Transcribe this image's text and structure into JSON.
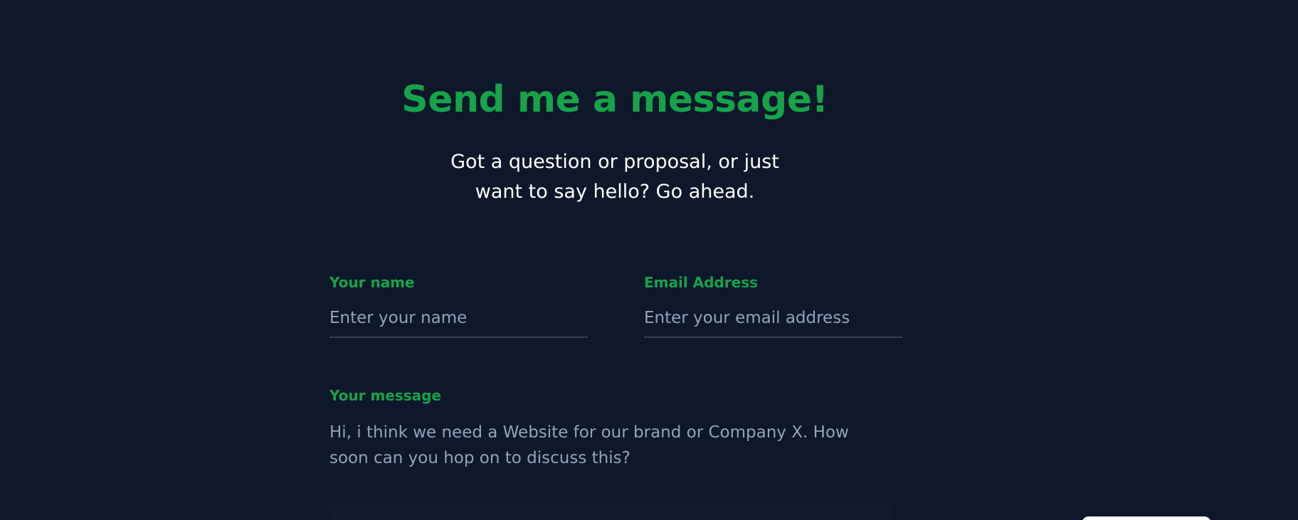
{
  "section": {
    "title": "Send me a message!",
    "subtitle": "Got a question or proposal, or just want to say hello? Go ahead."
  },
  "form": {
    "name": {
      "label": "Your name",
      "placeholder": "Enter your name",
      "value": ""
    },
    "email": {
      "label": "Email Address",
      "placeholder": "Enter your email address",
      "value": ""
    },
    "message": {
      "label": "Your message",
      "placeholder": "Hi, i think we need a Website for our brand or Company X. How soon can you hop on to discuss this?",
      "value": ""
    },
    "submit": {
      "label": ""
    }
  },
  "colors": {
    "background": "#0f172a",
    "accent": "#16a34a",
    "text": "#ffffff",
    "placeholder": "#94a3b8",
    "underline": "#3a4152"
  }
}
